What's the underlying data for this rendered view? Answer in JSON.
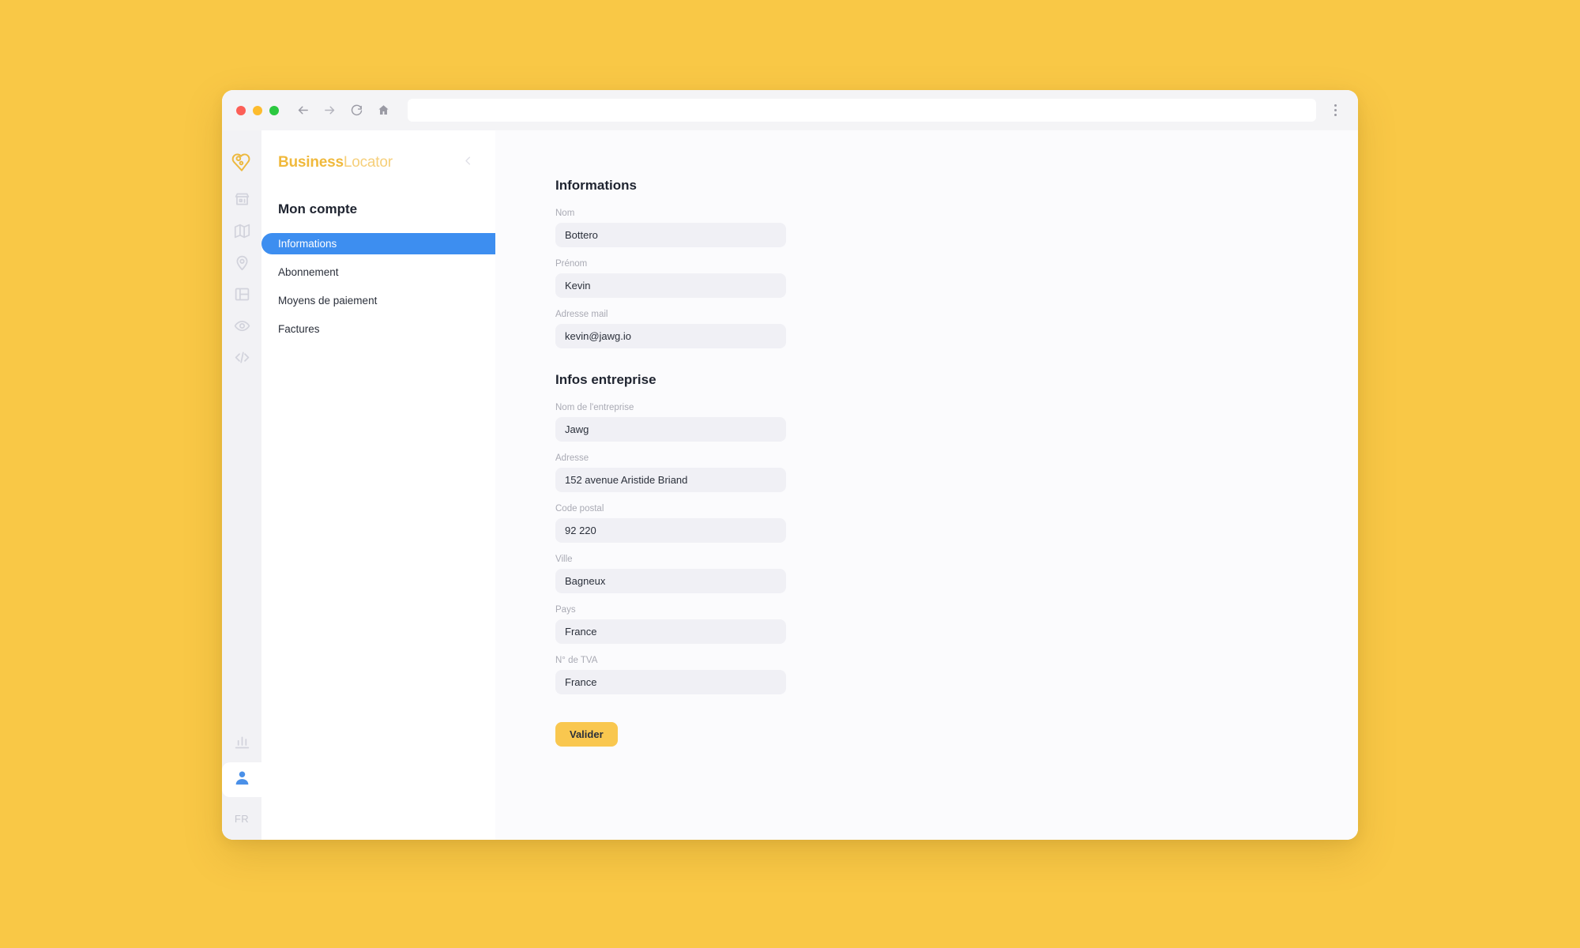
{
  "page": {
    "background_color": "#f9c846"
  },
  "browser": {
    "url_value": "",
    "url_placeholder": "",
    "back_icon": "back-arrow-icon",
    "forward_icon": "forward-arrow-icon",
    "reload_icon": "reload-icon",
    "home_icon": "home-icon",
    "menu_icon": "kebab-menu-icon"
  },
  "rail": {
    "logo_icon": "heart-b-logo-icon",
    "items": [
      {
        "icon": "store-icon",
        "active": false
      },
      {
        "icon": "map-icon",
        "active": false
      },
      {
        "icon": "location-pin-icon",
        "active": false
      },
      {
        "icon": "layout-columns-icon",
        "active": false
      },
      {
        "icon": "eye-icon",
        "active": false
      },
      {
        "icon": "code-icon",
        "active": false
      }
    ],
    "chart_icon": "bar-chart-icon",
    "account_icon": "person-icon",
    "language": "FR",
    "accent_color": "#3d8ef0"
  },
  "sidebar": {
    "brand_bold": "Business",
    "brand_light": "Locator",
    "collapse_icon": "chevron-left-icon",
    "title": "Mon compte",
    "items": [
      {
        "label": "Informations",
        "active": true
      },
      {
        "label": "Abonnement",
        "active": false
      },
      {
        "label": "Moyens de paiement",
        "active": false
      },
      {
        "label": "Factures",
        "active": false
      }
    ],
    "active_color": "#3d8ef0"
  },
  "main": {
    "section_personal": "Informations",
    "section_company": "Infos entreprise",
    "fields_personal": [
      {
        "label": "Nom",
        "value": "Bottero"
      },
      {
        "label": "Prénom",
        "value": "Kevin"
      },
      {
        "label": "Adresse mail",
        "value": "kevin@jawg.io"
      }
    ],
    "fields_company": [
      {
        "label": "Nom de l'entreprise",
        "value": "Jawg"
      },
      {
        "label": "Adresse",
        "value": "152 avenue Aristide Briand"
      },
      {
        "label": "Code postal",
        "value": "92 220"
      },
      {
        "label": "Ville",
        "value": "Bagneux"
      },
      {
        "label": "Pays",
        "value": "France"
      },
      {
        "label": "N° de TVA",
        "value": "France"
      }
    ],
    "submit_label": "Valider",
    "submit_color": "#f9c74f"
  }
}
